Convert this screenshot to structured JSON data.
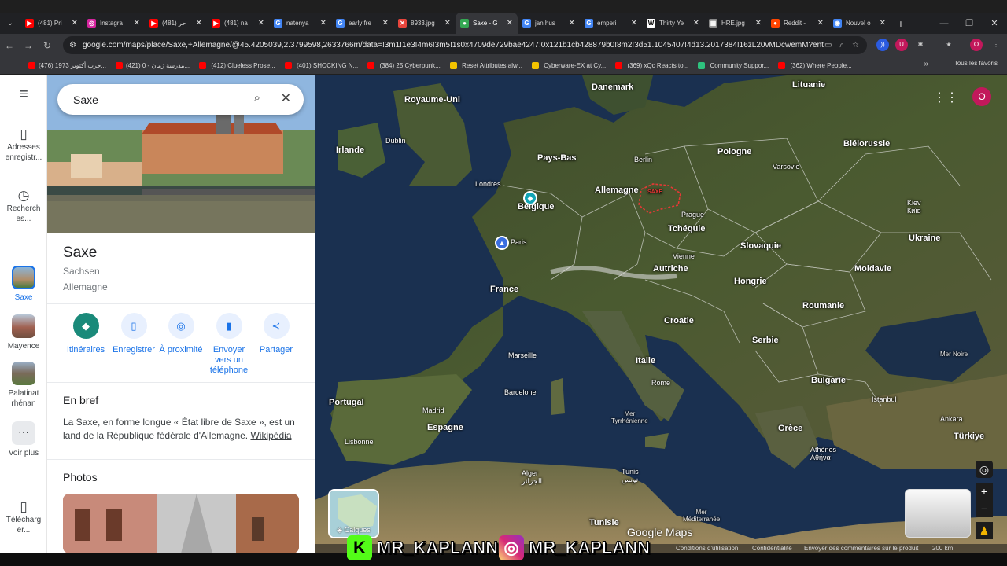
{
  "tabs": [
    {
      "title": "(481) Pri",
      "icon": "youtube-icon",
      "color": "#ff0000",
      "glyph": "▶"
    },
    {
      "title": "Instagra",
      "icon": "instagram-icon",
      "color": "#d6249f",
      "glyph": "◎"
    },
    {
      "title": "(481) حر",
      "icon": "youtube-icon",
      "color": "#ff0000",
      "glyph": "▶"
    },
    {
      "title": "(481) na",
      "icon": "youtube-icon",
      "color": "#ff0000",
      "glyph": "▶"
    },
    {
      "title": "natenya",
      "icon": "google-icon",
      "color": "#4285f4",
      "glyph": "G"
    },
    {
      "title": "early fre",
      "icon": "google-icon",
      "color": "#4285f4",
      "glyph": "G"
    },
    {
      "title": "8933.jpg",
      "icon": "image-icon",
      "color": "#e8453c",
      "glyph": "✕"
    },
    {
      "title": "Saxe - G",
      "icon": "maps-icon",
      "color": "#34a853",
      "glyph": "●"
    },
    {
      "title": "jan hus",
      "icon": "google-icon",
      "color": "#4285f4",
      "glyph": "G"
    },
    {
      "title": "emperi",
      "icon": "google-icon",
      "color": "#4285f4",
      "glyph": "G"
    },
    {
      "title": "Thirty Ye",
      "icon": "wikipedia-icon",
      "color": "#ffffff",
      "glyph": "W"
    },
    {
      "title": "HRE.jpg",
      "icon": "image-icon",
      "color": "#888888",
      "glyph": "▦"
    },
    {
      "title": "Reddit -",
      "icon": "reddit-icon",
      "color": "#ff4500",
      "glyph": "●"
    },
    {
      "title": "Nouvel o",
      "icon": "chrome-icon",
      "color": "#4285f4",
      "glyph": "◉"
    }
  ],
  "active_tab": 7,
  "url": "google.com/maps/place/Saxe,+Allemagne/@45.4205039,2.3799598,2633766m/data=!3m1!1e3!4m6!3m5!1s0x4709de729bae4247:0x121b1cb428879b0!8m2!3d51.1045407!4d13.2017384!16zL20vMDcwemM?entry=ttu&g_ep...",
  "bookmarks": [
    {
      "label": "حرب أكتوبر 1973...",
      "color": "#ff0000",
      "prefix": "(476)"
    },
    {
      "label": "مدرسة زمان - 0...",
      "color": "#ff0000",
      "prefix": "(421)"
    },
    {
      "label": "(412) Clueless Prose...",
      "color": "#ff0000",
      "prefix": ""
    },
    {
      "label": "(401) SHOCKING N...",
      "color": "#ff0000",
      "prefix": ""
    },
    {
      "label": "(384) 25 Cyberpunk...",
      "color": "#ff0000",
      "prefix": ""
    },
    {
      "label": "Reset Attributes alw...",
      "color": "#f2c200",
      "prefix": ""
    },
    {
      "label": "Cyberware-EX at Cy...",
      "color": "#f2c200",
      "prefix": ""
    },
    {
      "label": "(369) xQc Reacts to...",
      "color": "#ff0000",
      "prefix": ""
    },
    {
      "label": "Community Suppor...",
      "color": "#2ec27e",
      "prefix": ""
    },
    {
      "label": "(362) Where People...",
      "color": "#ff0000",
      "prefix": ""
    }
  ],
  "all_bookmarks": "Tous les favoris",
  "rail": {
    "saved": "Adresses enregistr...",
    "history": "Recherch es...",
    "recent": [
      {
        "label": "Saxe",
        "active": true
      },
      {
        "label": "Mayence",
        "active": false
      },
      {
        "label": "Palatinat rhénan",
        "active": false
      }
    ],
    "more": "Voir plus",
    "download": "Télécharg er..."
  },
  "search": {
    "value": "Saxe"
  },
  "place": {
    "title": "Saxe",
    "native_name": "Sachsen",
    "country": "Allemagne"
  },
  "actions": [
    {
      "label": "Itinéraires",
      "icon": "directions-icon",
      "glyph": "◆"
    },
    {
      "label": "Enregistrer",
      "icon": "bookmark-icon",
      "glyph": "▯"
    },
    {
      "label": "À proximité",
      "icon": "nearby-icon",
      "glyph": "◎"
    },
    {
      "label": "Envoyer vers un téléphone",
      "icon": "send-to-phone-icon",
      "glyph": "▮"
    },
    {
      "label": "Partager",
      "icon": "share-icon",
      "glyph": "≺"
    }
  ],
  "overview": {
    "heading": "En bref",
    "text": "La Saxe, en forme longue « État libre de Saxe », est un land de la République fédérale d'Allemagne.",
    "link": "Wikipédia"
  },
  "photos_heading": "Photos",
  "map": {
    "countries": [
      {
        "name": "Royaume-Uni"
      },
      {
        "name": "Irlande"
      },
      {
        "name": "Danemark"
      },
      {
        "name": "Lituanie"
      },
      {
        "name": "Pays-Bas"
      },
      {
        "name": "Belgique"
      },
      {
        "name": "Allemagne"
      },
      {
        "name": "Pologne"
      },
      {
        "name": "Biélorussie"
      },
      {
        "name": "Tchéquie"
      },
      {
        "name": "Slovaquie"
      },
      {
        "name": "Ukraine"
      },
      {
        "name": "France"
      },
      {
        "name": "Autriche"
      },
      {
        "name": "Hongrie"
      },
      {
        "name": "Moldavie"
      },
      {
        "name": "Roumanie"
      },
      {
        "name": "Croatie"
      },
      {
        "name": "Serbie"
      },
      {
        "name": "Italie"
      },
      {
        "name": "Bulgarie"
      },
      {
        "name": "Portugal"
      },
      {
        "name": "Espagne"
      },
      {
        "name": "Grèce"
      },
      {
        "name": "Türkiye"
      },
      {
        "name": "Tunisie"
      }
    ],
    "cities": [
      {
        "name": "Dublin"
      },
      {
        "name": "Londres"
      },
      {
        "name": "Berlin"
      },
      {
        "name": "Varsovie"
      },
      {
        "name": "Kiev\nКиїв"
      },
      {
        "name": "Paris"
      },
      {
        "name": "Prague"
      },
      {
        "name": "Vienne"
      },
      {
        "name": "Marseille"
      },
      {
        "name": "Rome"
      },
      {
        "name": "Barcelone"
      },
      {
        "name": "Madrid"
      },
      {
        "name": "Lisbonne"
      },
      {
        "name": "Istanbul"
      },
      {
        "name": "Ankara"
      },
      {
        "name": "Athènes\nΑθήνα"
      },
      {
        "name": "Alger\nالجزائر"
      },
      {
        "name": "Tunis\nتونس"
      }
    ],
    "seas": [
      {
        "name": "Mer\nTyrrhénienne"
      },
      {
        "name": "Mer Noire"
      },
      {
        "name": "Mer\nMéditerranée"
      }
    ],
    "region_tag": "SAXE",
    "layers_label": "Calques",
    "brand": "Google Maps",
    "footer": [
      "Conditions d'utilisation",
      "Confidentialité",
      "Envoyer des commentaires sur le produit"
    ],
    "scale": "200 km"
  },
  "watermark": "MR_KAPLANN"
}
